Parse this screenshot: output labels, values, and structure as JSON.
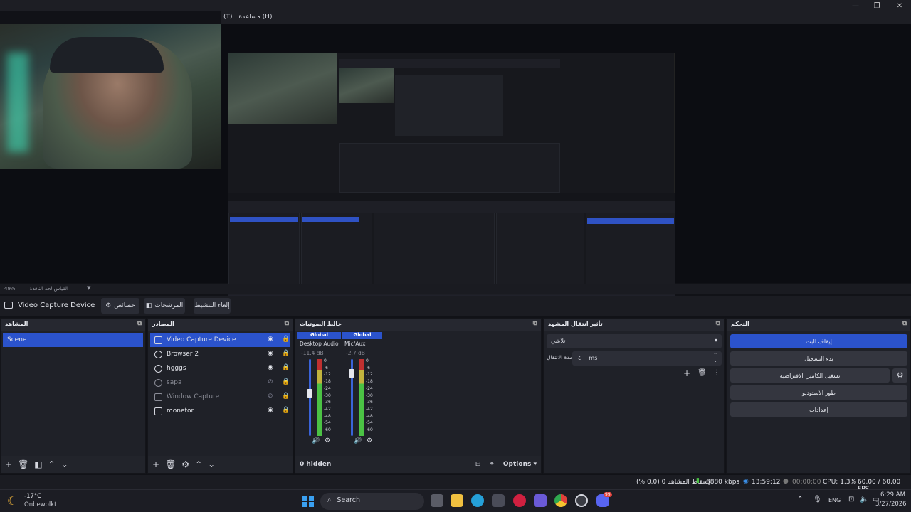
{
  "menubar": {
    "items": [
      "(T)",
      "مساعدة (H)"
    ]
  },
  "zoom": {
    "label": "49%",
    "mode": "القياس لحد النافذة"
  },
  "toolbar": {
    "source_name": "Video Capture Device",
    "properties": "خصائص",
    "filters": "المرشحات",
    "deactivate": "إلغاء التنشيط"
  },
  "docks": {
    "scenes": {
      "title": "المشاهد",
      "items": [
        "Scene"
      ]
    },
    "sources": {
      "title": "المصادر",
      "items": [
        {
          "label": "Video Capture Device",
          "icon": "camera-icon",
          "visible": true
        },
        {
          "label": "Browser 2",
          "icon": "globe-icon",
          "visible": true
        },
        {
          "label": "hgggs",
          "icon": "globe-icon",
          "visible": true
        },
        {
          "label": "sapa",
          "icon": "globe-icon",
          "visible": false
        },
        {
          "label": "Window Capture",
          "icon": "window-icon",
          "visible": false
        },
        {
          "label": "monetor",
          "icon": "monitor-icon",
          "visible": true
        }
      ]
    },
    "mixer": {
      "title": "خالط الصوتيات",
      "channels": [
        {
          "tag": "Global",
          "name": "Desktop Audio",
          "db": "-11.4 dB"
        },
        {
          "tag": "Global",
          "name": "Mic/Aux",
          "db": "-2.7 dB"
        }
      ],
      "scale": [
        "0",
        "-6",
        "-12",
        "-18",
        "-24",
        "-30",
        "-36",
        "-42",
        "-48",
        "-54",
        "-60"
      ],
      "hidden": "0 hidden",
      "options": "Options"
    },
    "transitions": {
      "title": "تأثير انتقال المشهد",
      "selected": "تلاشي",
      "duration_label": "مدة الانتقال",
      "duration_value": "٤٠٠ ms"
    },
    "controls": {
      "title": "التحكم",
      "stop_stream": "إيقاف البث",
      "start_recording": "بدء التسجيل",
      "virtual_camera": "تشغيل الكاميرا الافتراضية",
      "studio_mode": "طور الاستوديو",
      "settings": "إعدادات"
    }
  },
  "status": {
    "dropped": "إسقاط المشاهد 0 (0.0 %)",
    "bitrate": "6880 kbps",
    "stream_time": "13:59:12",
    "rec_time": "00:00:00",
    "cpu": "CPU: 1.3%",
    "fps": "60.00 / 60.00 FPS"
  },
  "taskbar": {
    "weather_temp": "-17°C",
    "weather_desc": "Onbewolkt",
    "search": "Search",
    "lang": "ENG",
    "time": "6:29 AM",
    "date": "3/27/2026",
    "discord_badge": "99"
  }
}
